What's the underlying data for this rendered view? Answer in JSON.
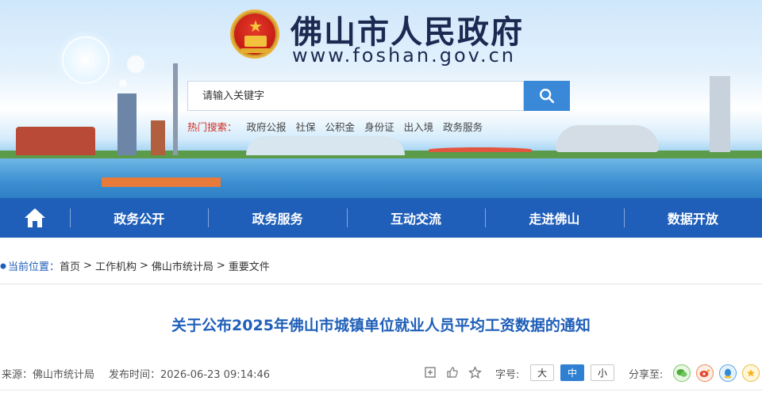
{
  "header": {
    "site_title": "佛山市人民政府",
    "site_domain": "www.foshan.gov.cn"
  },
  "search": {
    "placeholder": "请输入关键字"
  },
  "hot_search": {
    "label": "热门搜索：",
    "links": [
      "政府公报",
      "社保",
      "公积金",
      "身份证",
      "出入境",
      "政务服务"
    ]
  },
  "nav": {
    "items": [
      "政务公开",
      "政务服务",
      "互动交流",
      "走进佛山",
      "数据开放"
    ]
  },
  "breadcrumb": {
    "label": "当前位置：",
    "items": [
      "首页",
      "工作机构",
      "佛山市统计局",
      "重要文件"
    ],
    "separator": ">"
  },
  "article": {
    "title": "关于公布2025年佛山市城镇单位就业人员平均工资数据的通知",
    "source": "来源：佛山市统计局",
    "publish_time": "发布时间：2026-06-23 09:14:46"
  },
  "tools": {
    "font_label": "字号:",
    "font_sizes": [
      "大",
      "中",
      "小"
    ],
    "selected_font_size": "中",
    "share_label": "分享至:"
  },
  "colors": {
    "nav_bg": "#1f5fb9",
    "title_blue": "#1f5fb9",
    "hot_label_red": "#d22d22",
    "search_button": "#3a89d8"
  }
}
